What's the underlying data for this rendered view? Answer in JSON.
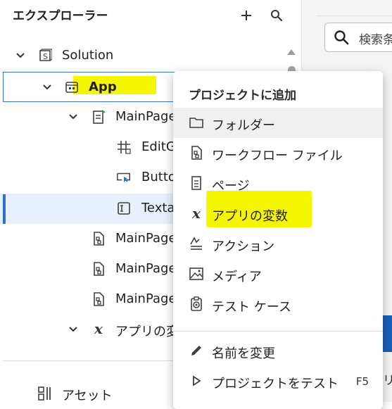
{
  "explorer": {
    "title": "エクスプローラー",
    "add_label": "+",
    "tree": {
      "solution": "Solution",
      "app": "App",
      "mainpage": "MainPage",
      "editgrid": "EditG",
      "button": "Butto",
      "textarea": "Texta",
      "mainpage_wf1": "MainPage",
      "mainpage_wf2": "MainPage",
      "mainpage_wf3": "MainPage",
      "app_variables": "アプリの変"
    },
    "assets_label": "アセット"
  },
  "search": {
    "placeholder": "検索条"
  },
  "context_menu": {
    "header": "プロジェクトに追加",
    "items": [
      {
        "label": "フォルダー",
        "icon": "folder-icon"
      },
      {
        "label": "ワークフロー ファイル",
        "icon": "workflow-file-icon"
      },
      {
        "label": "ページ",
        "icon": "page-icon"
      },
      {
        "label": "アプリの変数",
        "icon": "variable-icon"
      },
      {
        "label": "アクション",
        "icon": "action-icon"
      },
      {
        "label": "メディア",
        "icon": "media-icon"
      },
      {
        "label": "テスト ケース",
        "icon": "test-case-icon"
      }
    ],
    "rename": "名前を変更",
    "test_project": "プロジェクトをテスト",
    "test_shortcut": "F5"
  },
  "right_partial": "リ",
  "colors": {
    "selection_accent": "#2f6fd1",
    "highlight": "#f5f700"
  }
}
